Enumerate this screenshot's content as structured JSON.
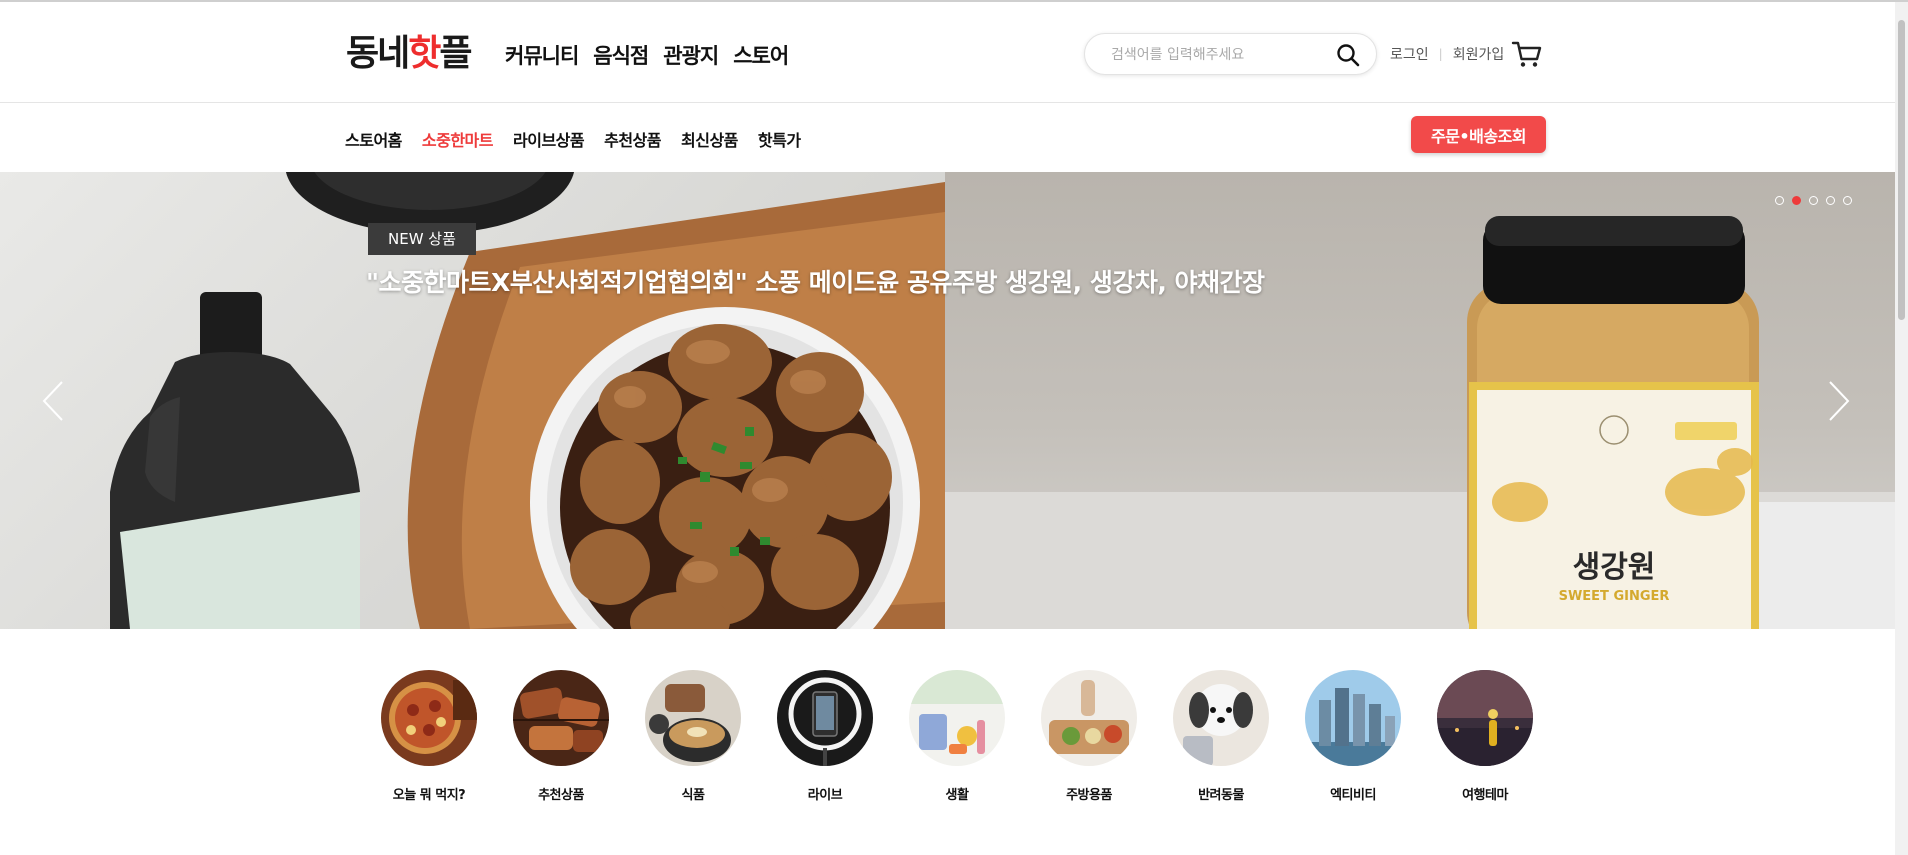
{
  "header": {
    "logo_pre": "동네",
    "logo_hot": "핫",
    "logo_post": "플",
    "gnb": [
      "커뮤니티",
      "음식점",
      "관광지",
      "스토어"
    ],
    "search_placeholder": "검색어를 입력해주세요",
    "login": "로그인",
    "separator": "|",
    "signup": "회원가입"
  },
  "subnav": {
    "items": [
      "스토어홈",
      "소중한마트",
      "라이브상품",
      "추천상품",
      "최신상품",
      "핫특가"
    ],
    "active_index": 1,
    "order_button": "주문•배송조회"
  },
  "banner": {
    "tag": "NEW 상품",
    "headline": "\"소중한마트X부산사회적기업협의회\" 소풍 메이드윤 공유주방 생강원, 생강차, 야채간장",
    "jar_label_kr": "생강원",
    "jar_label_en": "SWEET GINGER",
    "slide_count": 5,
    "active_slide": 2
  },
  "categories": [
    {
      "label": "오늘 뭐 먹지?",
      "icon": "pizza-food-photo"
    },
    {
      "label": "추천상품",
      "icon": "grilled-meat-photo"
    },
    {
      "label": "식품",
      "icon": "noodle-bowl-photo"
    },
    {
      "label": "라이브",
      "icon": "ring-light-phone-photo"
    },
    {
      "label": "생활",
      "icon": "household-items-photo"
    },
    {
      "label": "주방용품",
      "icon": "cutting-board-photo"
    },
    {
      "label": "반려동물",
      "icon": "puppy-photo"
    },
    {
      "label": "엑티비티",
      "icon": "city-skyline-photo"
    },
    {
      "label": "여행테마",
      "icon": "night-travel-photo"
    }
  ],
  "colors": {
    "accent": "#ee3b3b",
    "order_button": "#f24a4a"
  }
}
